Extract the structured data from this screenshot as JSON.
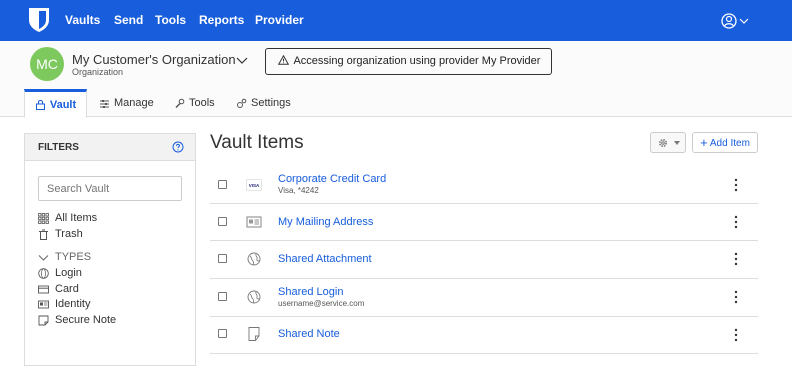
{
  "topnav": {
    "links": [
      "Vaults",
      "Send",
      "Tools",
      "Reports",
      "Provider"
    ],
    "logo_icon": "bitwarden-shield-icon",
    "account_icon": "user-circle-icon",
    "color": "#175ddc"
  },
  "org": {
    "initials": "MC",
    "name": "My Customer's Organization",
    "type": "Organization",
    "avatar_color": "#7dc95e"
  },
  "banner": {
    "icon": "warning-icon",
    "text": "Accessing organization using provider My Provider"
  },
  "tabs": [
    {
      "label": "Vault",
      "icon": "lock-icon"
    },
    {
      "label": "Manage",
      "icon": "sliders-icon"
    },
    {
      "label": "Tools",
      "icon": "wrench-icon"
    },
    {
      "label": "Settings",
      "icon": "cogs-icon"
    }
  ],
  "filters": {
    "title": "FILTERS",
    "search_placeholder": "Search Vault",
    "all_items": "All Items",
    "trash": "Trash",
    "types_label": "TYPES",
    "types": [
      "Login",
      "Card",
      "Identity",
      "Secure Note"
    ]
  },
  "main": {
    "title": "Vault Items",
    "add_label": "Add Item",
    "items": [
      {
        "name": "Corporate Credit Card",
        "subtitle": "Visa, *4242",
        "icon": "visa-card-icon"
      },
      {
        "name": "My Mailing Address",
        "subtitle": "",
        "icon": "identity-card-icon"
      },
      {
        "name": "Shared Attachment",
        "subtitle": "",
        "icon": "globe-icon"
      },
      {
        "name": "Shared Login",
        "subtitle": "username@service.com",
        "icon": "globe-icon"
      },
      {
        "name": "Shared Note",
        "subtitle": "",
        "icon": "note-icon"
      }
    ]
  }
}
